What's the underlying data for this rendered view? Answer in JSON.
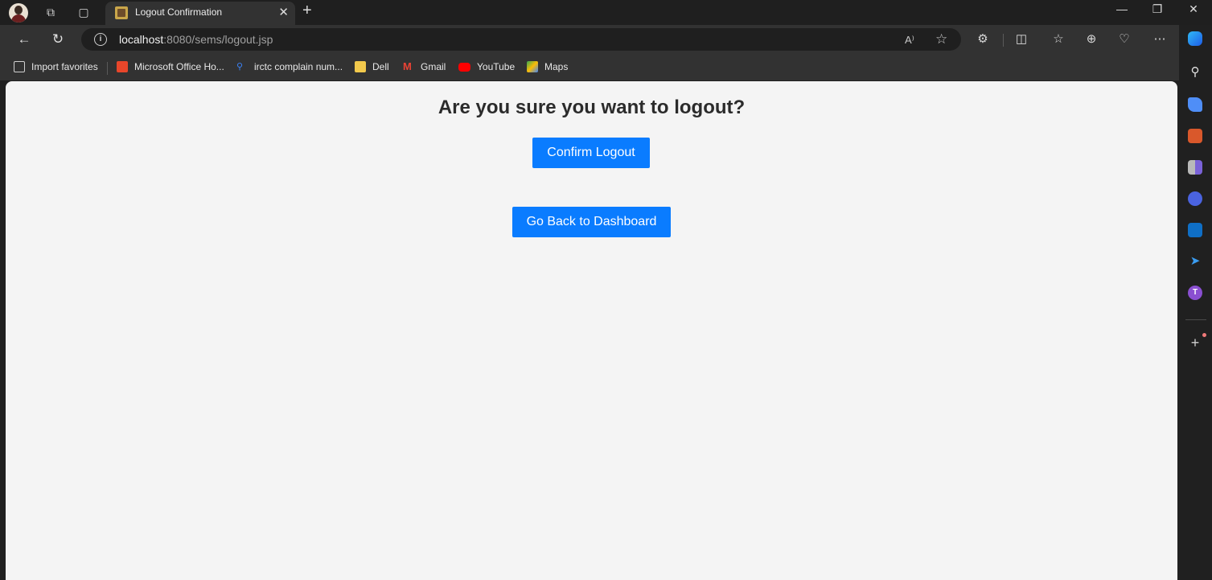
{
  "window": {
    "tab_title": "Logout Confirmation",
    "tab_close_icon": "close-icon",
    "new_tab_icon": "plus-icon",
    "controls": {
      "minimize": "—",
      "restore": "❐",
      "close": "✕"
    }
  },
  "navbar": {
    "back_icon": "←",
    "refresh_icon": "↻",
    "url_host": "localhost",
    "url_path": ":8080/sems/logout.jsp",
    "read_aloud_icon": "A⁾",
    "favorite_icon": "☆"
  },
  "bookmarks": [
    {
      "label": "Import favorites",
      "color": "#d0d0d0"
    },
    {
      "label": "Microsoft Office Ho...",
      "color": "#e8462a"
    },
    {
      "label": "irctc complain num...",
      "color": "#3b82f6"
    },
    {
      "label": "Dell",
      "color": "#f2c94c"
    },
    {
      "label": "Gmail",
      "color": "#ea4335"
    },
    {
      "label": "YouTube",
      "color": "#ff0000"
    },
    {
      "label": "Maps",
      "color": "#34a853"
    }
  ],
  "page": {
    "heading": "Are you sure you want to logout?",
    "confirm_label": "Confirm Logout",
    "back_label": "Go Back to Dashboard",
    "button_color": "#0a7cff"
  }
}
